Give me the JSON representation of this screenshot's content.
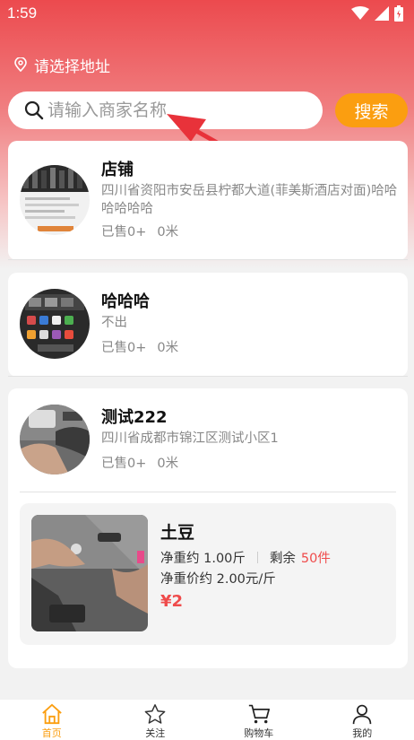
{
  "status_bar": {
    "time": "1:59"
  },
  "location": {
    "text": "请选择地址",
    "icon": "location-pin-icon"
  },
  "search": {
    "placeholder": "请输入商家名称",
    "value": "",
    "button_label": "搜索",
    "icon": "search-icon"
  },
  "stores": [
    {
      "name": "店铺",
      "address": "四川省资阳市安岳县柠都大道(菲美斯酒店对面)哈哈哈哈哈哈",
      "sold": "已售0+",
      "distance": "0米"
    },
    {
      "name": "哈哈哈",
      "address": "不出",
      "sold": "已售0+",
      "distance": "0米"
    },
    {
      "name": "测试222",
      "address": "四川省成都市锦江区测试小区1",
      "sold": "已售0+",
      "distance": "0米",
      "products": [
        {
          "name": "土豆",
          "weight": "净重约 1.00斤",
          "stock_label": "剩余",
          "stock_value": "50件",
          "unit_price": "净重价约 2.00元/斤",
          "price": "¥2"
        }
      ]
    }
  ],
  "tabbar": [
    {
      "label": "首页",
      "icon": "home-icon",
      "active": true
    },
    {
      "label": "关注",
      "icon": "star-icon",
      "active": false
    },
    {
      "label": "购物车",
      "icon": "cart-icon",
      "active": false
    },
    {
      "label": "我的",
      "icon": "user-icon",
      "active": false
    }
  ],
  "colors": {
    "header_red": "#ec4a4e",
    "accent_orange": "#fb9e10",
    "price_red": "#ef4b4b"
  }
}
